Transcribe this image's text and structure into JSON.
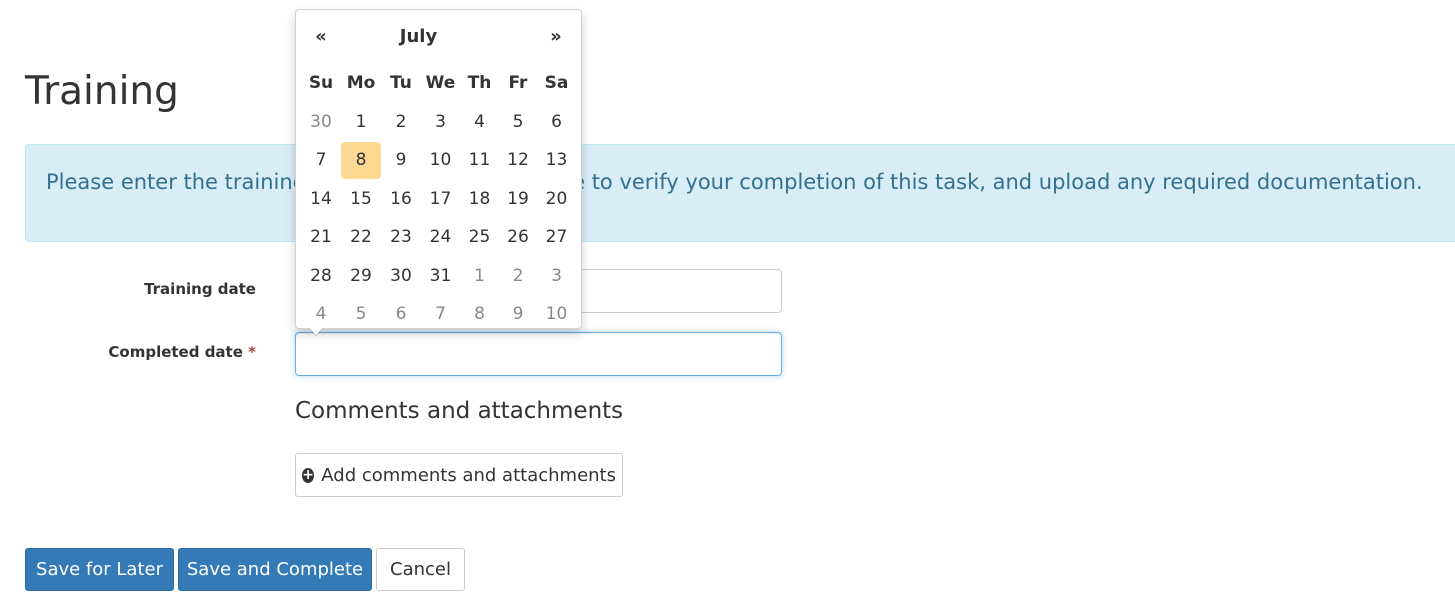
{
  "page": {
    "title": "Training",
    "info_message": "Please enter the training date, and completed date to verify your completion of this task, and upload any required documentation."
  },
  "form": {
    "training_date_label": "Training date",
    "training_date_value": "",
    "completed_date_label": "Completed date",
    "required_marker": "*",
    "completed_date_value": ""
  },
  "attachments": {
    "heading": "Comments and attachments",
    "add_button_label": "Add comments and attachments",
    "add_icon": "plus-circle-icon"
  },
  "actions": {
    "save_later_label": "Save for Later",
    "save_complete_label": "Save and Complete",
    "cancel_label": "Cancel"
  },
  "datepicker": {
    "prev_label": "«",
    "next_label": "»",
    "month_label": "July",
    "weekdays": [
      "Su",
      "Mo",
      "Tu",
      "We",
      "Th",
      "Fr",
      "Sa"
    ],
    "weeks": [
      [
        {
          "d": "30",
          "muted": true
        },
        {
          "d": "1"
        },
        {
          "d": "2"
        },
        {
          "d": "3"
        },
        {
          "d": "4"
        },
        {
          "d": "5"
        },
        {
          "d": "6"
        }
      ],
      [
        {
          "d": "7"
        },
        {
          "d": "8",
          "today": true
        },
        {
          "d": "9"
        },
        {
          "d": "10"
        },
        {
          "d": "11"
        },
        {
          "d": "12"
        },
        {
          "d": "13"
        }
      ],
      [
        {
          "d": "14"
        },
        {
          "d": "15"
        },
        {
          "d": "16"
        },
        {
          "d": "17"
        },
        {
          "d": "18"
        },
        {
          "d": "19"
        },
        {
          "d": "20"
        }
      ],
      [
        {
          "d": "21"
        },
        {
          "d": "22"
        },
        {
          "d": "23"
        },
        {
          "d": "24"
        },
        {
          "d": "25"
        },
        {
          "d": "26"
        },
        {
          "d": "27"
        }
      ],
      [
        {
          "d": "28"
        },
        {
          "d": "29"
        },
        {
          "d": "30"
        },
        {
          "d": "31"
        },
        {
          "d": "1",
          "muted": true
        },
        {
          "d": "2",
          "muted": true
        },
        {
          "d": "3",
          "muted": true
        }
      ],
      [
        {
          "d": "4",
          "muted": true
        },
        {
          "d": "5",
          "muted": true
        },
        {
          "d": "6",
          "muted": true
        },
        {
          "d": "7",
          "muted": true
        },
        {
          "d": "8",
          "muted": true
        },
        {
          "d": "9",
          "muted": true
        },
        {
          "d": "10",
          "muted": true
        }
      ]
    ],
    "today_highlight_color": "#fdd994"
  },
  "colors": {
    "primary": "#337ab7",
    "info_background": "#d9edf7",
    "info_text": "#31708f",
    "required": "#a94442"
  }
}
